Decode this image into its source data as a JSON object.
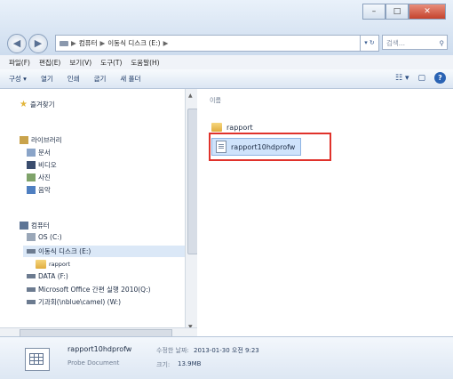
{
  "window": {
    "min_glyph": "–",
    "max_glyph": "□",
    "close_glyph": "✕"
  },
  "nav_buttons": {
    "back": "◀",
    "forward": "▶"
  },
  "address_bar": {
    "crumbs": [
      "컴퓨터",
      "이동식 디스크 (E:)"
    ],
    "separator": "▶",
    "dropdown": "▾ ↻",
    "search_placeholder": "검색...",
    "search_icon": "⚲"
  },
  "menu": [
    "파일(F)",
    "편집(E)",
    "보기(V)",
    "도구(T)",
    "도움말(H)"
  ],
  "commands": [
    "구성 ▾",
    "열기",
    "인쇄",
    "굽기",
    "새 폴더"
  ],
  "view_controls": {
    "views": "☷ ▾",
    "preview": "▢",
    "help": "?"
  },
  "nav_pane": {
    "favorites": "즐겨찾기",
    "libraries": "라이브러리",
    "library_items": [
      "문서",
      "비디오",
      "사진",
      "음악"
    ],
    "computer": "컴퓨터",
    "drives": [
      "OS (C:)",
      "이동식 디스크 (E:)",
      "rapport",
      "DATA (F:)",
      "Microsoft Office 간편 실행 2010(Q:)",
      "기과회(\\nblue\\camel) (W:)"
    ]
  },
  "file_pane": {
    "column_header": "이름",
    "files": [
      {
        "name": "rapport",
        "type": "folder"
      },
      {
        "name": "rapport10hdprofw",
        "type": "document"
      }
    ]
  },
  "details": {
    "file_name": "rapport10hdprofw",
    "file_type": "Probe Document",
    "modified_label": "수정한 날짜:",
    "modified_value": "2013-01-30 오전 9:23",
    "size_label": "크기:",
    "size_value": "13.9MB"
  },
  "colors": {
    "accent": "#2a63b4",
    "highlight_box": "#e0322b",
    "folder": "#e0ad3f"
  }
}
